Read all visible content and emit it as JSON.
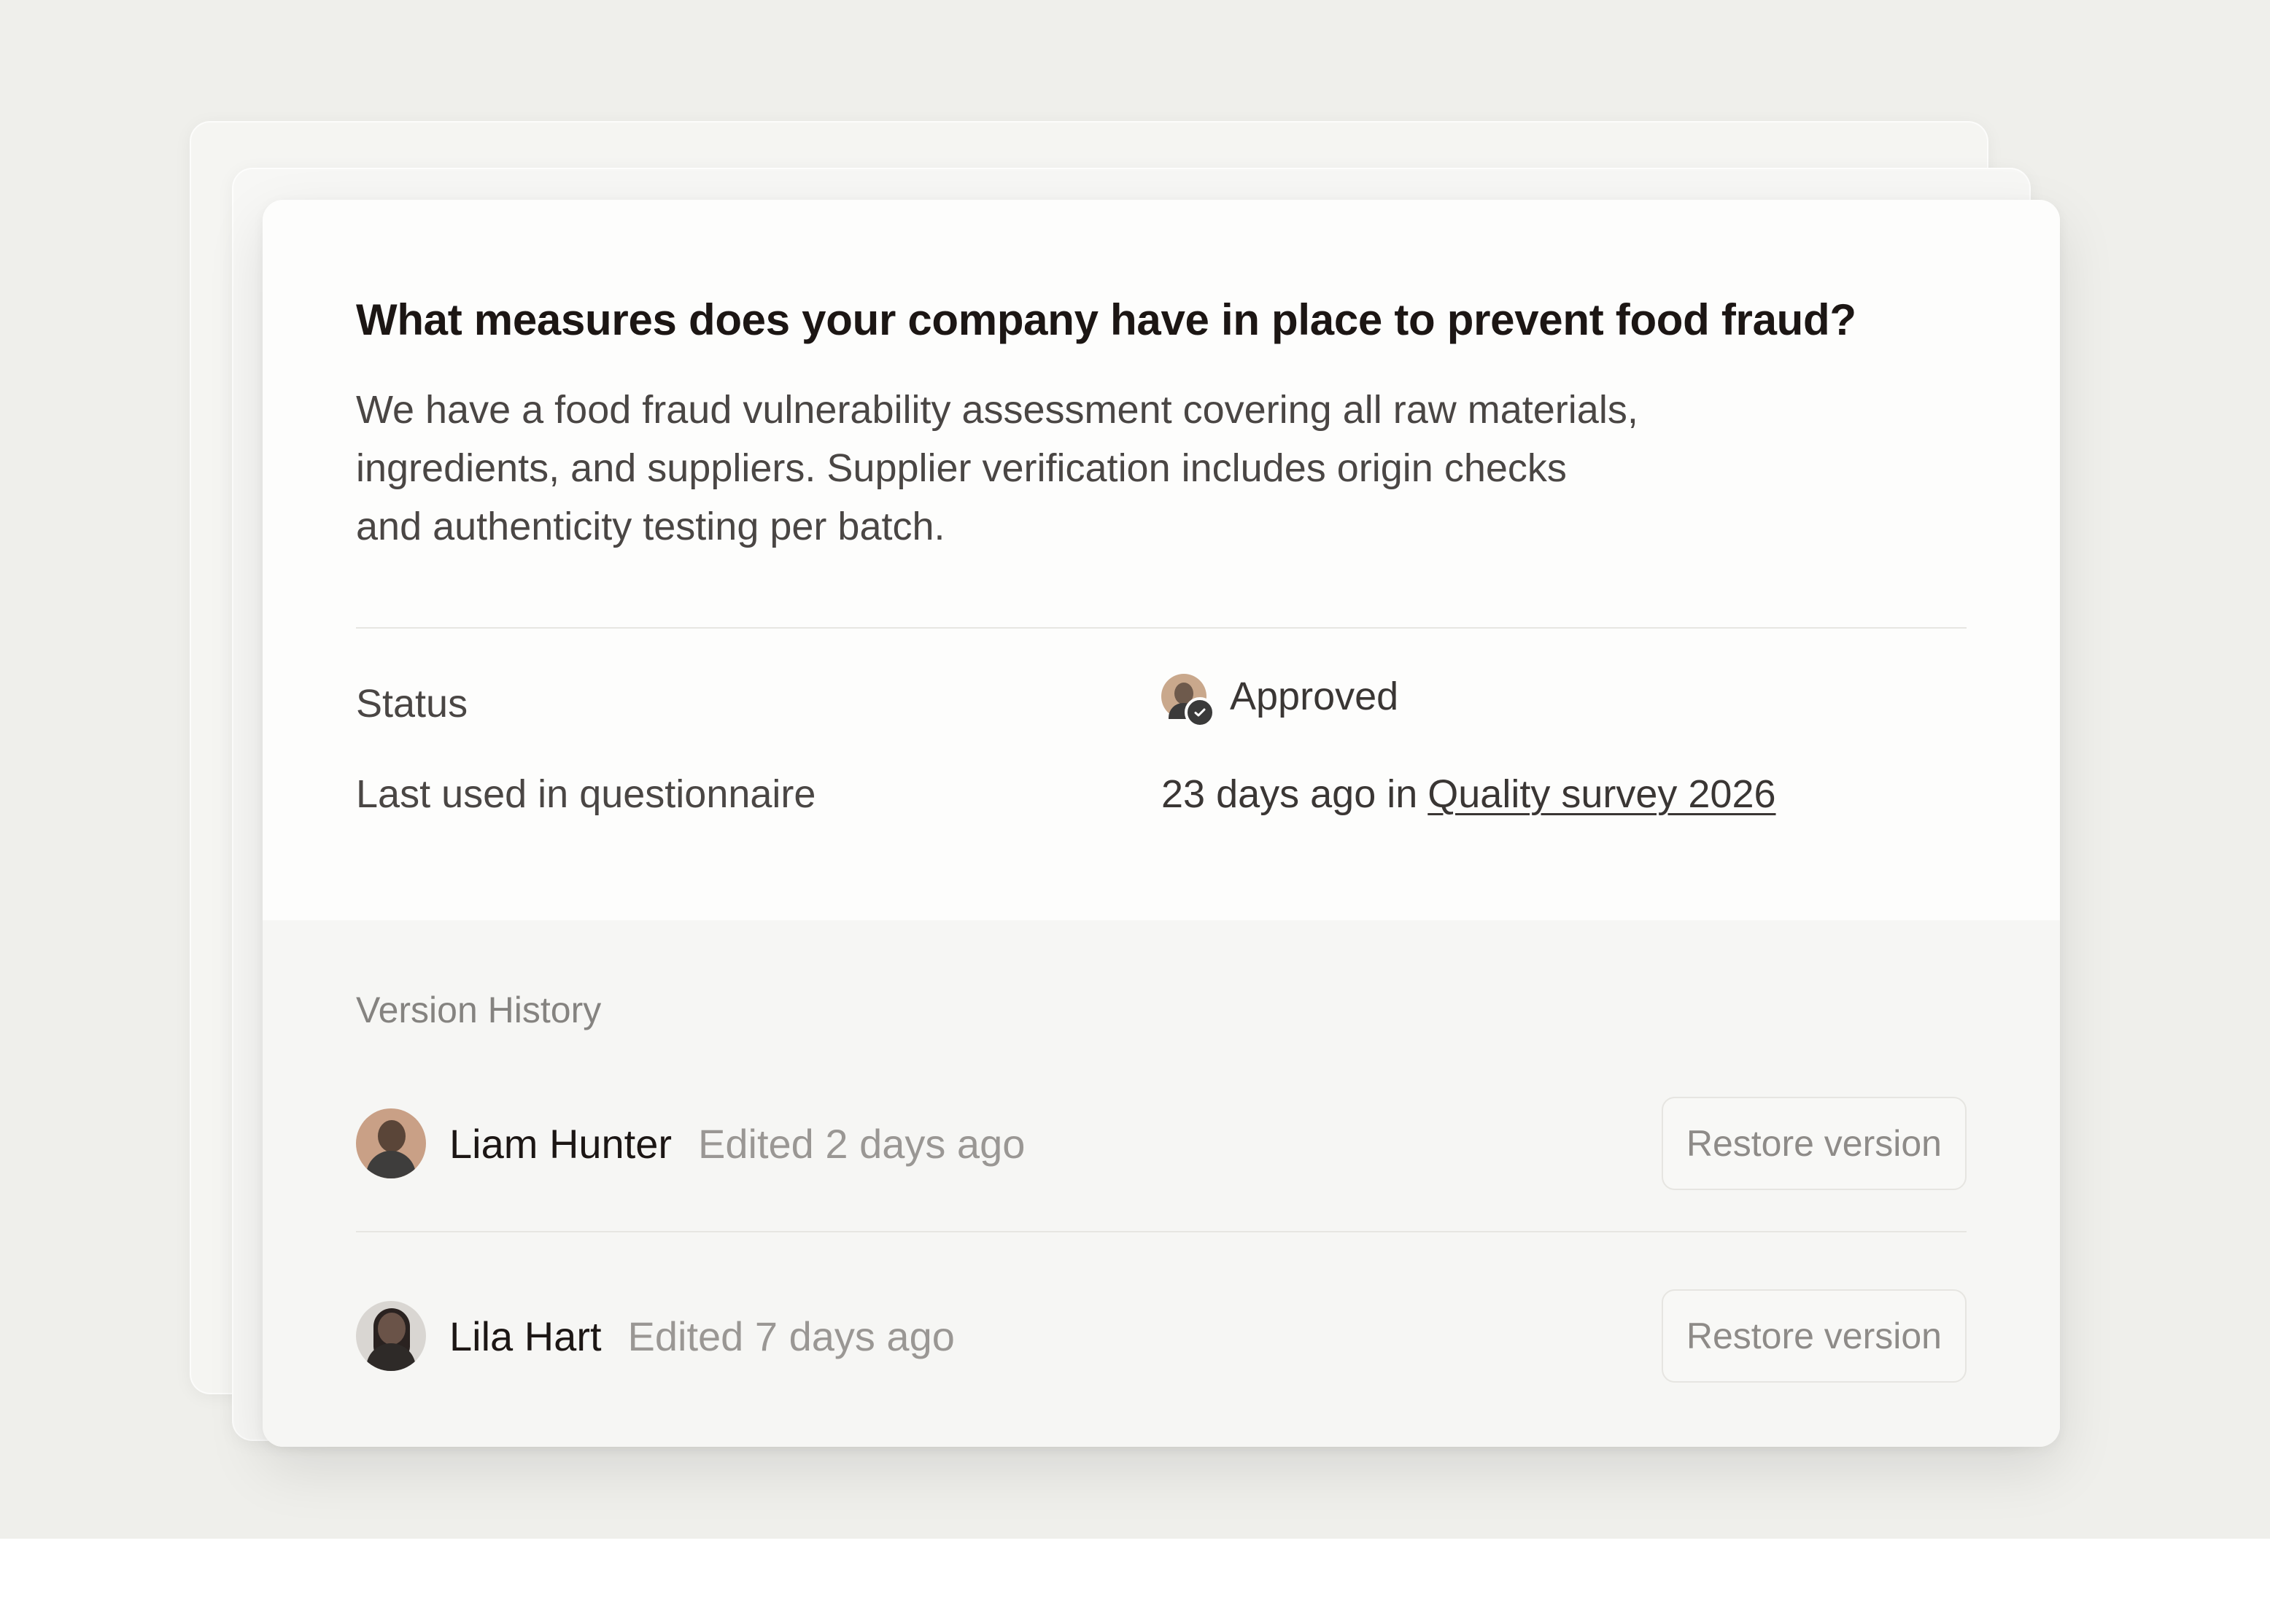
{
  "question": {
    "title": "What measures does your company have in place to prevent food fraud?",
    "answer": "We have a food fraud vulnerability assessment covering all raw materials,\ningredients, and suppliers. Supplier verification includes origin checks\nand authenticity testing per batch."
  },
  "meta": {
    "status_label": "Status",
    "status_value": "Approved",
    "last_used_label": "Last used in questionnaire",
    "last_used_prefix": "23 days ago in",
    "last_used_link": "Quality survey 2026"
  },
  "version_history": {
    "title": "Version History",
    "entries": [
      {
        "name": "Liam Hunter",
        "edited": "Edited 2 days ago",
        "action": "Restore version"
      },
      {
        "name": "Lila Hart",
        "edited": "Edited 7 days ago",
        "action": "Restore version"
      }
    ]
  },
  "icons": {
    "status_avatar": "approver-avatar-icon",
    "check": "check-badge-icon"
  },
  "colors": {
    "background": "#efefeb",
    "card": "#fdfdfc",
    "heading": "#1c1614",
    "muted": "#9a9794"
  }
}
